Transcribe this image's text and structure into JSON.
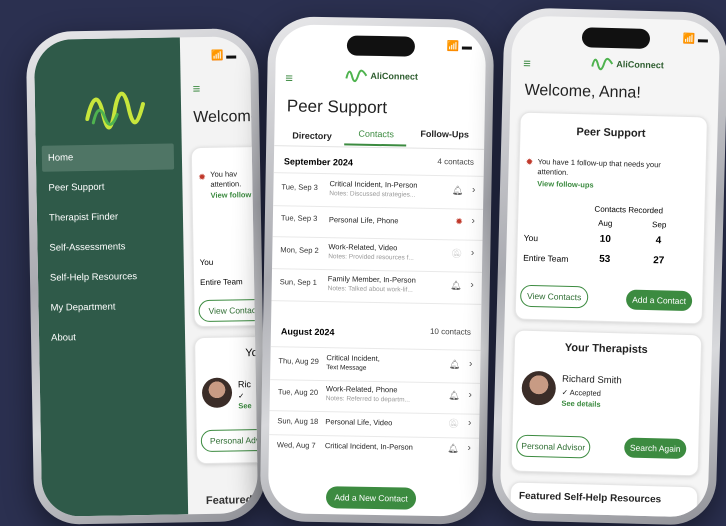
{
  "phone1": {
    "menu": [
      "Home",
      "Peer Support",
      "Therapist Finder",
      "Self-Assessments",
      "Self-Help Resources",
      "My Department",
      "About"
    ],
    "bg_title": "Welcome",
    "alert": "You have 1 follow-up that needs your attention.",
    "alert_short": "You hav",
    "alert_attention": "attention.",
    "link": "View follow",
    "you": "You",
    "team": "Entire Team",
    "view_contacts": "View Contacts",
    "your": "Yo",
    "ric": "Ric",
    "check": "✓",
    "see": "See",
    "personal": "Personal Advisor",
    "featured": "Featured"
  },
  "phone2": {
    "time_icons": "📶 ▬",
    "app_name": "AliConnect",
    "title": "Peer Support",
    "tabs": [
      "Directory",
      "Contacts",
      "Follow-Ups"
    ],
    "sections": [
      {
        "month": "September 2024",
        "count": "4 contacts",
        "rows": [
          {
            "date": "Tue, Sep 3",
            "title": "Critical Incident, In-Person",
            "note": "Notes: Discussed strategies...",
            "icon": "bell"
          },
          {
            "date": "Tue, Sep 3",
            "title": "Personal Life, Phone",
            "note": "",
            "icon": "alarm"
          },
          {
            "date": "Mon, Sep 2",
            "title": "Work-Related, Video",
            "note": "Notes: Provided resources f...",
            "icon": "muted"
          },
          {
            "date": "Sun, Sep 1",
            "title": "Family Member, In-Person",
            "note": "Notes: Talked about work-lif...",
            "icon": "bell"
          }
        ]
      },
      {
        "month": "August 2024",
        "count": "10 contacts",
        "rows": [
          {
            "date": "Thu, Aug 29",
            "title": "Critical Incident,",
            "note": "Text Message",
            "icon": "bell"
          },
          {
            "date": "Tue, Aug 20",
            "title": "Work-Related, Phone",
            "note": "Notes: Referred to departm...",
            "icon": "bell"
          },
          {
            "date": "Sun, Aug 18",
            "title": "Personal Life, Video",
            "note": "",
            "icon": "muted"
          },
          {
            "date": "Wed, Aug 7",
            "title": "Critical Incident, In-Person",
            "note": "",
            "icon": "bell"
          }
        ]
      }
    ],
    "add_button": "Add a New Contact"
  },
  "phone3": {
    "app_name": "AliConnect",
    "welcome": "Welcome, Anna!",
    "peer_title": "Peer Support",
    "alert": "You have 1 follow-up that needs your attention.",
    "alert_line1": "You have 1 follow-up that needs your",
    "alert_line2": "attention.",
    "view_followups": "View follow-ups",
    "contacts_recorded": "Contacts Recorded",
    "col_aug": "Aug",
    "col_sep": "Sep",
    "you_label": "You",
    "you_aug": "10",
    "you_sep": "4",
    "team_label": "Entire Team",
    "team_aug": "53",
    "team_sep": "27",
    "view_contacts": "View Contacts",
    "add_contact": "Add a Contact",
    "therapists_title": "Your Therapists",
    "therapist_name": "Richard Smith",
    "accepted": "✓ Accepted",
    "see_details": "See details",
    "personal_advisor": "Personal Advisor",
    "search_again": "Search Again",
    "featured": "Featured Self-Help Resources"
  },
  "colors": {
    "accent": "#3c8b40",
    "menu_bg": "#2f5a49",
    "menu_active": "#4f7565",
    "background": "#2b3050"
  }
}
